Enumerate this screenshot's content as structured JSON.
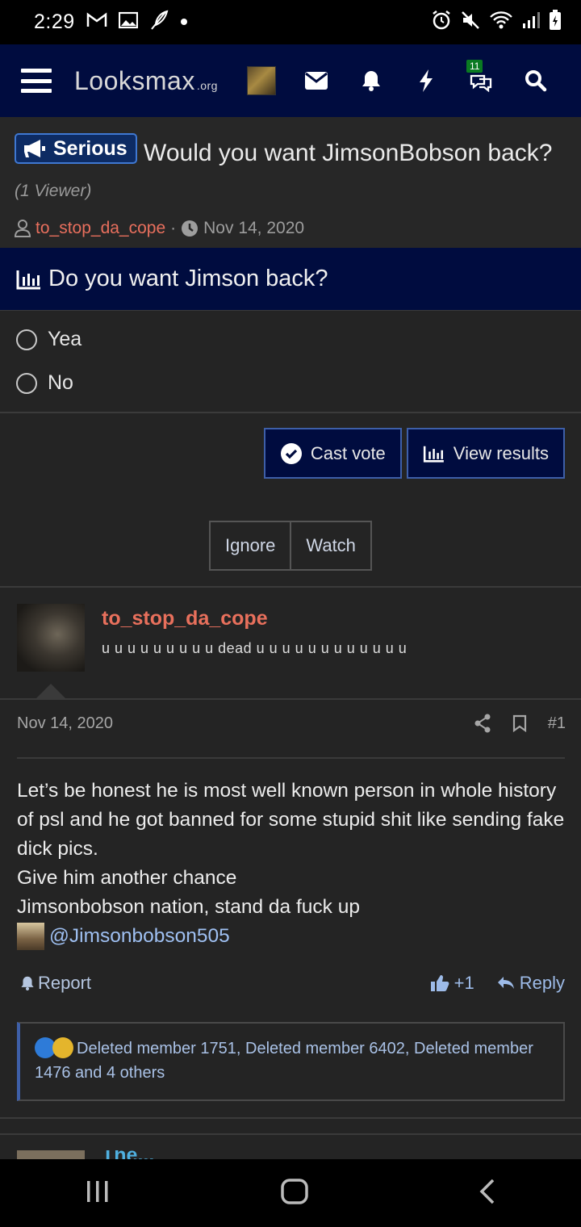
{
  "status_bar": {
    "time": "2:29"
  },
  "navbar": {
    "logo": "Looksmax",
    "logo_suffix": ".org",
    "conversations_badge": "11"
  },
  "thread": {
    "prefix": "Serious",
    "title": "Would you want JimsonBobson back?",
    "viewers": "(1 Viewer)",
    "author": "to_stop_da_cope",
    "date": "Nov 14, 2020"
  },
  "poll": {
    "question": "Do you want Jimson back?",
    "options": [
      "Yea",
      "No"
    ],
    "cast_vote_label": "Cast vote",
    "view_results_label": "View results"
  },
  "thread_actions": {
    "ignore_label": "Ignore",
    "watch_label": "Watch"
  },
  "post": {
    "username": "to_stop_da_cope",
    "user_title": "u u u u u u u u u dead u u u u u u u u u u u u",
    "date": "Nov 14, 2020",
    "number": "#1",
    "body_lines": [
      "Let’s be honest he is most well known person in whole history of psl and he got banned for some stupid shit like sending fake dick pics.",
      "Give him another chance",
      "Jimsonbobson nation, stand da fuck up"
    ],
    "mention": "@Jimsonbobson505",
    "report_label": "Report",
    "like_label": "+1",
    "reply_label": "Reply",
    "reactions_text": "Deleted member 1751, Deleted member 6402, Deleted member 1476 and 4 others"
  },
  "next_post": {
    "username_peek": "The..."
  },
  "colors": {
    "nav_bg": "#000c3f",
    "page_bg": "#242424",
    "author_color": "#e86f5d",
    "link_color": "#9fc0f2"
  }
}
